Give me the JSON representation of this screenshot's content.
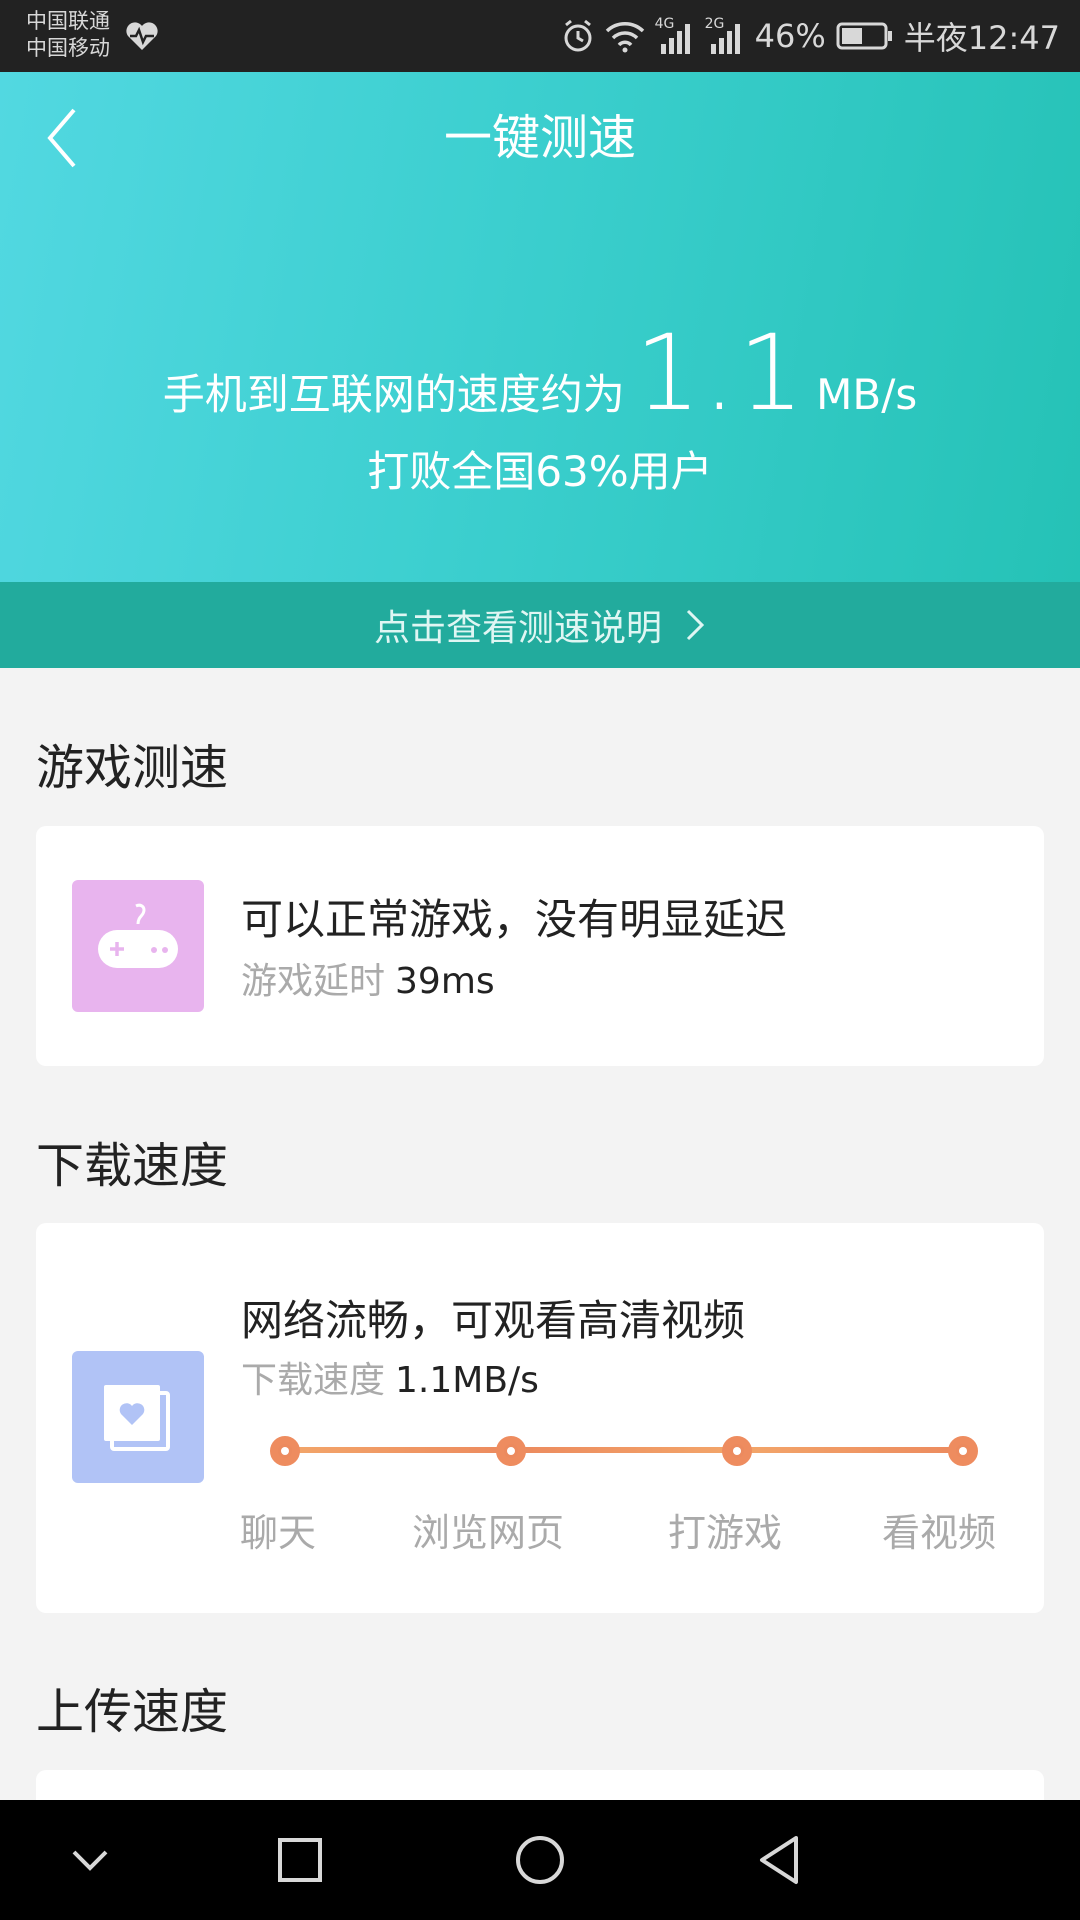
{
  "status_bar": {
    "carrier_1": "中国联通",
    "carrier_2": "中国移动",
    "net_1": "4G",
    "net_2": "2G",
    "battery": "46%",
    "time": "半夜12:47"
  },
  "header": {
    "title": "一键测速",
    "speed_prefix": "手机到互联网的速度约为",
    "speed_value": "1.1",
    "speed_unit": "MB/s",
    "beat_text": "打败全国63%用户"
  },
  "info_strip": {
    "label": "点击查看测速说明"
  },
  "game_section": {
    "title": "游戏测速",
    "card_title": "可以正常游戏，没有明显延迟",
    "sub_label": "游戏延时",
    "sub_value": "39ms"
  },
  "download_section": {
    "title": "下载速度",
    "card_title": "网络流畅，可观看高清视频",
    "sub_label": "下载速度",
    "sub_value": "1.1MB/s",
    "levels": [
      "聊天",
      "浏览网页",
      "打游戏",
      "看视频"
    ]
  },
  "upload_section": {
    "title": "上传速度"
  },
  "colors": {
    "header_start": "#52d8e1",
    "header_end": "#25c2b6",
    "strip": "#22ab9d",
    "game_icon_bg": "#e8b4ee",
    "video_icon_bg": "#b1c3f6",
    "track": "#ec8a5e"
  }
}
